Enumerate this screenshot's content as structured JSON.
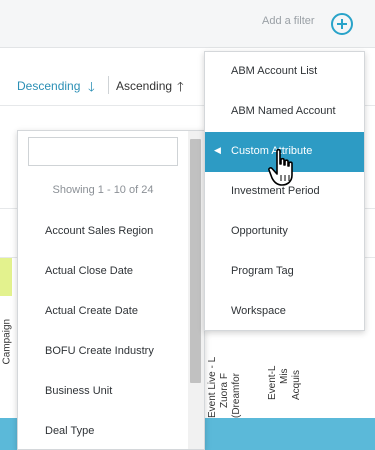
{
  "header": {
    "add_filter_label": "Add a filter"
  },
  "sort": {
    "descending_label": "Descending",
    "descending_arrow": "🡓",
    "ascending_label": "Ascending",
    "ascending_arrow": "🡑"
  },
  "table": {
    "campaign_label": "Campaign",
    "column_labels": [
      "Event Live - L",
      "Zuora F",
      "(Dreamfor",
      "Event-L",
      "Mis",
      "Acquis"
    ]
  },
  "attribute_dropdown": {
    "search_value": "",
    "showing_text": "Showing 1 - 10 of 24",
    "items": [
      "Account Sales Region",
      "Actual Close Date",
      "Actual Create Date",
      "BOFU Create Industry",
      "Business Unit",
      "Deal Type"
    ]
  },
  "filter_menu": {
    "items": [
      {
        "label": "ABM Account List",
        "active": false
      },
      {
        "label": "ABM Named Account",
        "active": false
      },
      {
        "label": "Custom Attribute",
        "active": true
      },
      {
        "label": "Investment Period",
        "active": false
      },
      {
        "label": "Opportunity",
        "active": false
      },
      {
        "label": "Program Tag",
        "active": false
      },
      {
        "label": "Workspace",
        "active": false
      }
    ],
    "active_caret": "◀"
  },
  "colors": {
    "accent": "#2d9bc4",
    "highlight_cell": "#e3f28e",
    "bottom_bar": "#5bb9d9"
  },
  "icons": [
    "add-filter-plus-icon",
    "hand-pointer-cursor-icon"
  ]
}
